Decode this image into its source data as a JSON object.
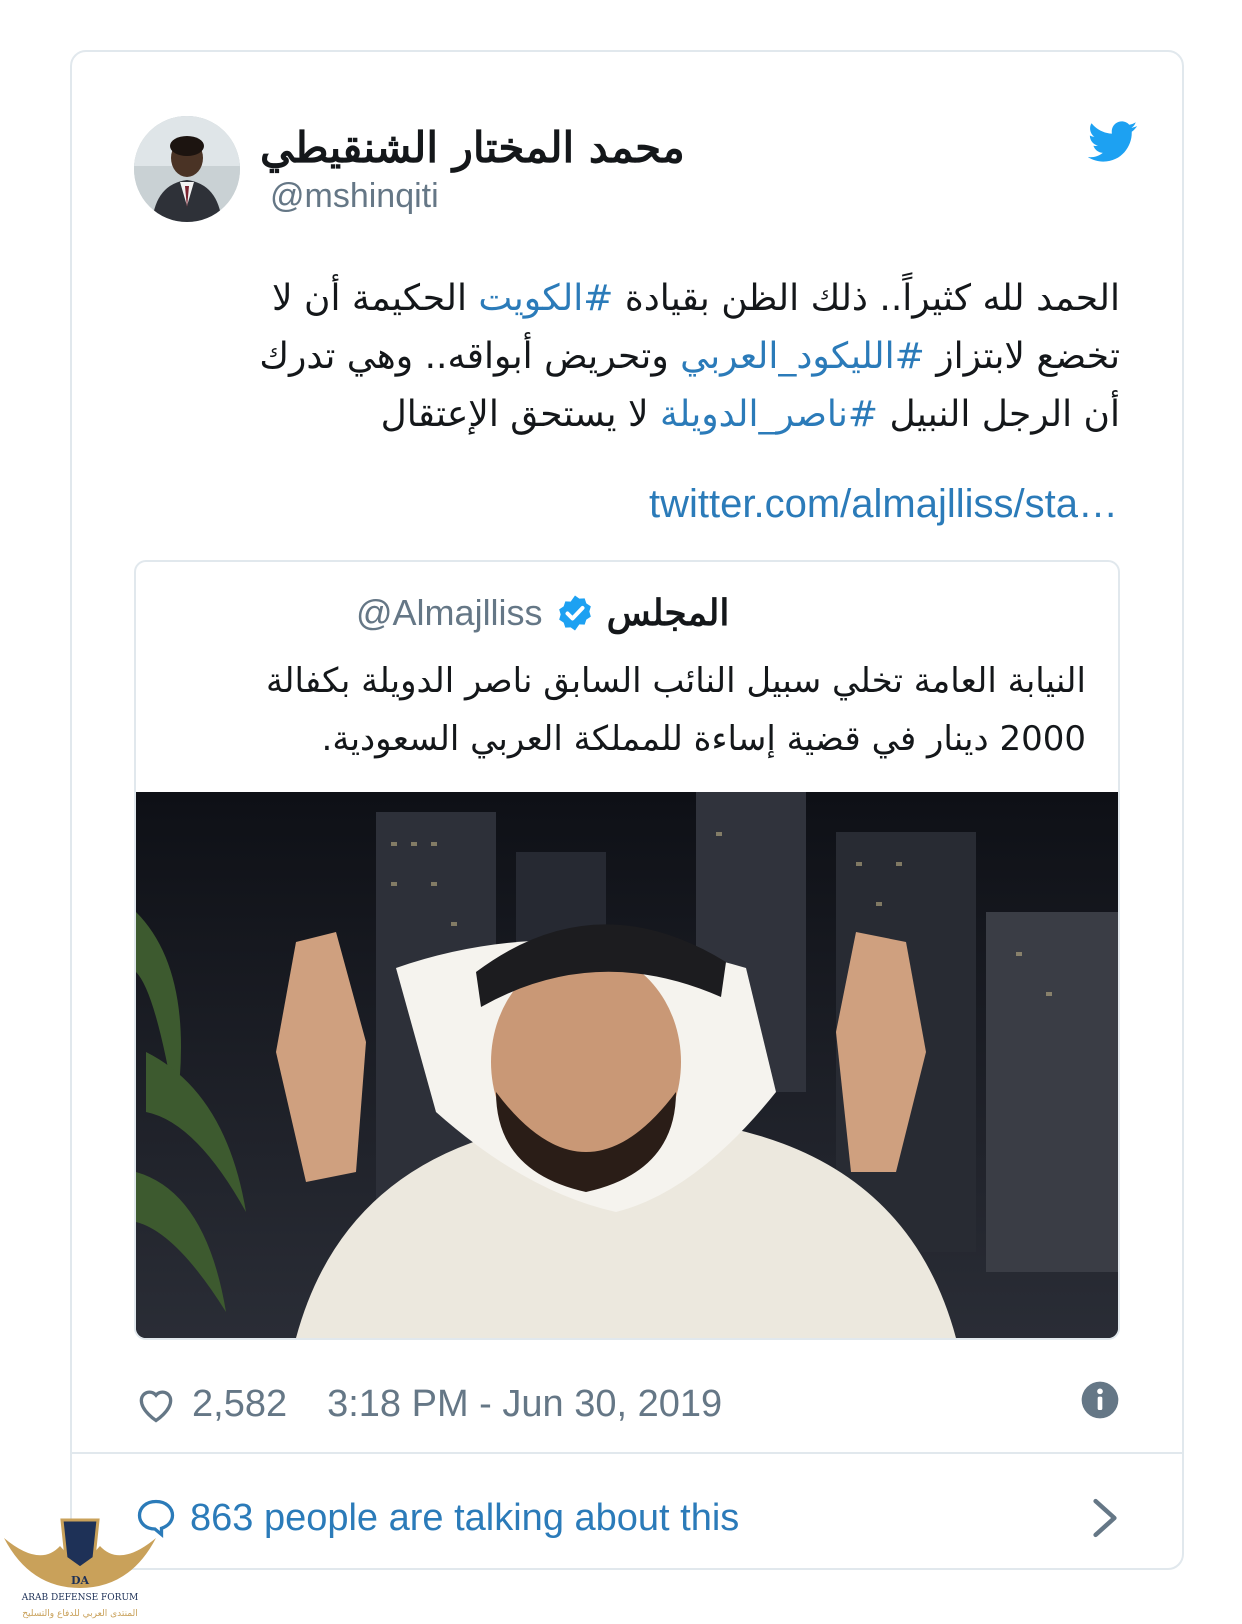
{
  "author": {
    "display_name": "محمد المختار الشنقيطي",
    "handle": "@mshinqiti"
  },
  "tweet": {
    "line1_a": "الحمد لله كثيراً.. ذلك الظن بقيادة ",
    "line1_hashtag": "#الكويت",
    "line1_b": " الحكيمة أن لا",
    "line2_a": "تخضع لابتزاز ",
    "line2_hashtag": "#الليكود_العربي",
    "line2_b": " وتحريض أبواقه.. وهي تدرك",
    "line3_a": "أن الرجل النبيل  ",
    "line3_hashtag": "#ناصر_الدويلة",
    "line3_b": " لا يستحق الإعتقال",
    "link": "twitter.com/almajlliss/sta…"
  },
  "quoted_tweet": {
    "handle": "@Almajlliss",
    "name": "المجلس",
    "text_line1": "النيابة العامة تخلي سبيل النائب السابق ناصر الدويلة بكفالة",
    "text_line2": "2000 دينار في قضية إساءة للمملكة العربي السعودية."
  },
  "footer": {
    "like_count": "2,582",
    "timestamp": "3:18 PM - Jun 30, 2019",
    "talking": "863 people are talking about this"
  },
  "watermark": {
    "title": "ARAB DEFENSE FORUM",
    "subtitle": "المنتدى العربي للدفاع والتسليح",
    "logo_text": "DA"
  },
  "icons": [
    "twitter-bird-icon",
    "verified-badge-icon",
    "heart-icon",
    "info-icon",
    "speech-bubble-icon",
    "chevron-right-icon"
  ],
  "colors": {
    "link": "#2b7bb9",
    "twitter_blue": "#1da1f2",
    "muted": "#657786",
    "border": "#e1e8ed"
  }
}
